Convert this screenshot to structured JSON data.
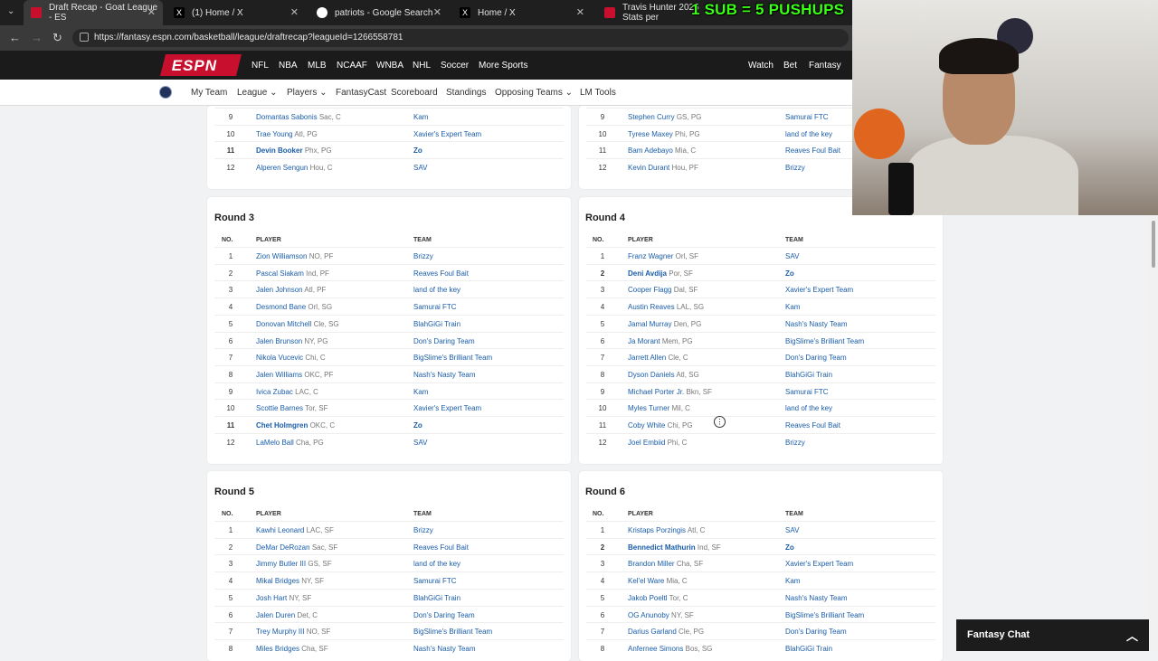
{
  "browser": {
    "tabs": [
      {
        "title": "Draft Recap - Goat League - ESPN",
        "display": "Draft Recap - Goat League - ES",
        "icon": "espn-favicon-icon",
        "favicon_color": "#c8102e"
      },
      {
        "title": "(1) Home / X",
        "display": "(1) Home / X",
        "icon": "x-favicon-icon",
        "favicon_color": "#000000"
      },
      {
        "title": "patriots - Google Search",
        "display": "patriots - Google Search",
        "icon": "google-favicon-icon",
        "favicon_color": "#ffffff"
      },
      {
        "title": "Home / X",
        "display": "Home / X",
        "icon": "x-favicon-icon",
        "favicon_color": "#000000"
      },
      {
        "title": "Travis Hunter 2025 Stats",
        "display": "Travis Hunter 2025 Stats per",
        "icon": "espn-favicon-icon",
        "favicon_color": "#c8102e"
      }
    ],
    "url": "https://fantasy.espn.com/basketball/league/draftrecap?leagueId=1266558781",
    "overlay_text": "1 SUB = 5 PUSHUPS"
  },
  "espn_nav": {
    "logo": "ESPN",
    "items": [
      "NFL",
      "NBA",
      "MLB",
      "NCAAF",
      "WNBA",
      "NHL",
      "Soccer",
      "More Sports"
    ],
    "right_items": [
      "Watch",
      "Bet",
      "Fantasy"
    ]
  },
  "sub_nav": {
    "items": [
      "My Team",
      "League",
      "Players",
      "FantasyCast",
      "Scoreboard",
      "Standings",
      "Opposing Teams",
      "LM Tools"
    ]
  },
  "headers": {
    "no": "NO.",
    "player": "PLAYER",
    "team": "TEAM"
  },
  "top_left_rows": [
    {
      "no": "9",
      "name": "Domantas Sabonis",
      "meta": "Sac, C",
      "team": "Kam",
      "mine": false
    },
    {
      "no": "10",
      "name": "Trae Young",
      "meta": "Atl, PG",
      "team": "Xavier's Expert Team",
      "mine": false
    },
    {
      "no": "11",
      "name": "Devin Booker",
      "meta": "Phx, PG",
      "team": "Zo",
      "mine": true
    },
    {
      "no": "12",
      "name": "Alperen Sengun",
      "meta": "Hou, C",
      "team": "SAV",
      "mine": false
    }
  ],
  "top_right_rows": [
    {
      "no": "9",
      "name": "Stephen Curry",
      "meta": "GS, PG",
      "team": "Samurai FTC",
      "mine": false
    },
    {
      "no": "10",
      "name": "Tyrese Maxey",
      "meta": "Phi, PG",
      "team": "land of the key",
      "mine": false
    },
    {
      "no": "11",
      "name": "Bam Adebayo",
      "meta": "Mia, C",
      "team": "Reaves Foul Bait",
      "mine": false
    },
    {
      "no": "12",
      "name": "Kevin Durant",
      "meta": "Hou, PF",
      "team": "Brizzy",
      "mine": false
    }
  ],
  "rounds": {
    "r3": {
      "title": "Round 3",
      "rows": [
        {
          "no": "1",
          "name": "Zion Williamson",
          "meta": "NO, PF",
          "team": "Brizzy",
          "mine": false
        },
        {
          "no": "2",
          "name": "Pascal Siakam",
          "meta": "Ind, PF",
          "team": "Reaves Foul Bait",
          "mine": false
        },
        {
          "no": "3",
          "name": "Jalen Johnson",
          "meta": "Atl, PF",
          "team": "land of the key",
          "mine": false
        },
        {
          "no": "4",
          "name": "Desmond Bane",
          "meta": "Orl, SG",
          "team": "Samurai FTC",
          "mine": false
        },
        {
          "no": "5",
          "name": "Donovan Mitchell",
          "meta": "Cle, SG",
          "team": "BlahGiGi Train",
          "mine": false
        },
        {
          "no": "6",
          "name": "Jalen Brunson",
          "meta": "NY, PG",
          "team": "Don's Daring Team",
          "mine": false
        },
        {
          "no": "7",
          "name": "Nikola Vucevic",
          "meta": "Chi, C",
          "team": "BigSlime's Brilliant Team",
          "mine": false
        },
        {
          "no": "8",
          "name": "Jalen Williams",
          "meta": "OKC, PF",
          "team": "Nash's Nasty Team",
          "mine": false
        },
        {
          "no": "9",
          "name": "Ivica Zubac",
          "meta": "LAC, C",
          "team": "Kam",
          "mine": false
        },
        {
          "no": "10",
          "name": "Scottie Barnes",
          "meta": "Tor, SF",
          "team": "Xavier's Expert Team",
          "mine": false
        },
        {
          "no": "11",
          "name": "Chet Holmgren",
          "meta": "OKC, C",
          "team": "Zo",
          "mine": true
        },
        {
          "no": "12",
          "name": "LaMelo Ball",
          "meta": "Cha, PG",
          "team": "SAV",
          "mine": false
        }
      ]
    },
    "r4": {
      "title": "Round 4",
      "rows": [
        {
          "no": "1",
          "name": "Franz Wagner",
          "meta": "Orl, SF",
          "team": "SAV",
          "mine": false
        },
        {
          "no": "2",
          "name": "Deni Avdija",
          "meta": "Por, SF",
          "team": "Zo",
          "mine": true
        },
        {
          "no": "3",
          "name": "Cooper Flagg",
          "meta": "Dal, SF",
          "team": "Xavier's Expert Team",
          "mine": false
        },
        {
          "no": "4",
          "name": "Austin Reaves",
          "meta": "LAL, SG",
          "team": "Kam",
          "mine": false
        },
        {
          "no": "5",
          "name": "Jamal Murray",
          "meta": "Den, PG",
          "team": "Nash's Nasty Team",
          "mine": false
        },
        {
          "no": "6",
          "name": "Ja Morant",
          "meta": "Mem, PG",
          "team": "BigSlime's Brilliant Team",
          "mine": false
        },
        {
          "no": "7",
          "name": "Jarrett Allen",
          "meta": "Cle, C",
          "team": "Don's Daring Team",
          "mine": false
        },
        {
          "no": "8",
          "name": "Dyson Daniels",
          "meta": "Atl, SG",
          "team": "BlahGiGi Train",
          "mine": false
        },
        {
          "no": "9",
          "name": "Michael Porter Jr.",
          "meta": "Bkn, SF",
          "team": "Samurai FTC",
          "mine": false
        },
        {
          "no": "10",
          "name": "Myles Turner",
          "meta": "Mil, C",
          "team": "land of the key",
          "mine": false
        },
        {
          "no": "11",
          "name": "Coby White",
          "meta": "Chi, PG",
          "team": "Reaves Foul Bait",
          "mine": false
        },
        {
          "no": "12",
          "name": "Joel Embiid",
          "meta": "Phi, C",
          "team": "Brizzy",
          "mine": false
        }
      ]
    },
    "r5": {
      "title": "Round 5",
      "rows": [
        {
          "no": "1",
          "name": "Kawhi Leonard",
          "meta": "LAC, SF",
          "team": "Brizzy",
          "mine": false
        },
        {
          "no": "2",
          "name": "DeMar DeRozan",
          "meta": "Sac, SF",
          "team": "Reaves Foul Bait",
          "mine": false
        },
        {
          "no": "3",
          "name": "Jimmy Butler III",
          "meta": "GS, SF",
          "team": "land of the key",
          "mine": false
        },
        {
          "no": "4",
          "name": "Mikal Bridges",
          "meta": "NY, SF",
          "team": "Samurai FTC",
          "mine": false
        },
        {
          "no": "5",
          "name": "Josh Hart",
          "meta": "NY, SF",
          "team": "BlahGiGi Train",
          "mine": false
        },
        {
          "no": "6",
          "name": "Jalen Duren",
          "meta": "Det, C",
          "team": "Don's Daring Team",
          "mine": false
        },
        {
          "no": "7",
          "name": "Trey Murphy III",
          "meta": "NO, SF",
          "team": "BigSlime's Brilliant Team",
          "mine": false
        },
        {
          "no": "8",
          "name": "Miles Bridges",
          "meta": "Cha, SF",
          "team": "Nash's Nasty Team",
          "mine": false
        }
      ]
    },
    "r6": {
      "title": "Round 6",
      "rows": [
        {
          "no": "1",
          "name": "Kristaps Porzingis",
          "meta": "Atl, C",
          "team": "SAV",
          "mine": false
        },
        {
          "no": "2",
          "name": "Bennedict Mathurin",
          "meta": "Ind, SF",
          "team": "Zo",
          "mine": true
        },
        {
          "no": "3",
          "name": "Brandon Miller",
          "meta": "Cha, SF",
          "team": "Xavier's Expert Team",
          "mine": false
        },
        {
          "no": "4",
          "name": "Kel'el Ware",
          "meta": "Mia, C",
          "team": "Kam",
          "mine": false
        },
        {
          "no": "5",
          "name": "Jakob Poeltl",
          "meta": "Tor, C",
          "team": "Nash's Nasty Team",
          "mine": false
        },
        {
          "no": "6",
          "name": "OG Anunoby",
          "meta": "NY, SF",
          "team": "BigSlime's Brilliant Team",
          "mine": false
        },
        {
          "no": "7",
          "name": "Darius Garland",
          "meta": "Cle, PG",
          "team": "Don's Daring Team",
          "mine": false
        },
        {
          "no": "8",
          "name": "Anfernee Simons",
          "meta": "Bos, SG",
          "team": "BlahGiGi Train",
          "mine": false
        }
      ]
    }
  },
  "chat": {
    "label": "Fantasy Chat"
  },
  "colors": {
    "link": "#1a5daa",
    "espn_red": "#c8102e",
    "overlay_green": "#39ff14"
  }
}
